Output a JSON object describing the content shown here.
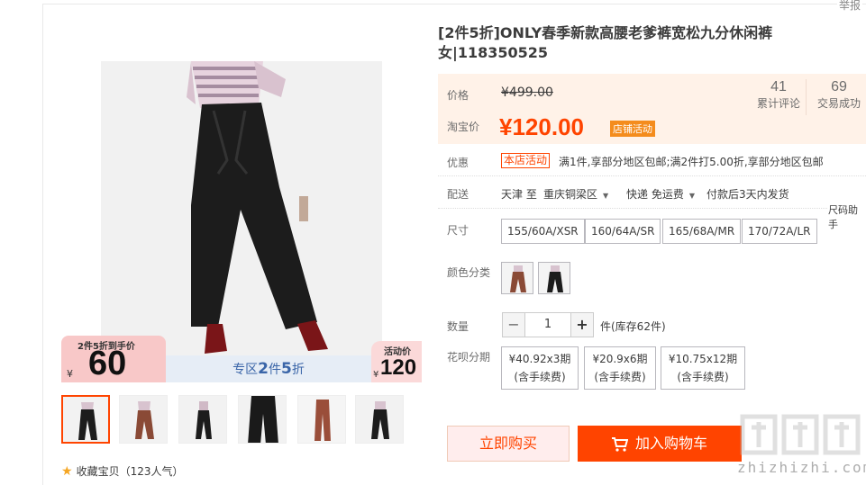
{
  "header": {
    "report": "举报"
  },
  "product": {
    "title": "[2件5折]ONLY春季新款高腰老爹裤宽松九分休闲裤女|118350525"
  },
  "promo_banner": {
    "left_small": "2件5折到手价",
    "left_yen": "¥",
    "left_price": "60",
    "mid_prefix": "专区",
    "mid_bold1": "2",
    "mid_text": "件",
    "mid_bold2": "5",
    "mid_suffix": "折",
    "right_small": "活动价",
    "right_yen": "¥",
    "right_price": "120"
  },
  "favorite": {
    "icon": "star-icon",
    "label": "收藏宝贝（123人气）"
  },
  "price": {
    "label_price": "价格",
    "original": "¥499.00",
    "label_tb": "淘宝价",
    "current": "¥120.00",
    "store_tag": "店铺活动",
    "reviews_num": "41",
    "reviews_label": "累计评论",
    "deals_num": "69",
    "deals_label": "交易成功"
  },
  "promotion": {
    "label": "优惠",
    "tag": "本店活动",
    "text": "满1件,享部分地区包邮;满2件打5.00折,享部分地区包邮"
  },
  "shipping": {
    "label": "配送",
    "from": "天津 至",
    "to": "重庆铜梁区",
    "method": "快递 免运费",
    "promise": "付款后3天内发货"
  },
  "size_help": "尺码助手",
  "sizes": {
    "label": "尺寸",
    "options": [
      "155/60A/XSR",
      "160/64A/SR",
      "165/68A/MR",
      "170/72A/LR"
    ]
  },
  "colors": {
    "label": "颜色分类"
  },
  "quantity": {
    "label": "数量",
    "minus": "−",
    "value": "1",
    "plus": "+",
    "stock": "件(库存62件)"
  },
  "installments": {
    "label": "花呗分期",
    "options": [
      {
        "line1": "¥40.92x3期",
        "line2": "(含手续费)"
      },
      {
        "line1": "¥20.9x6期",
        "line2": "(含手续费)"
      },
      {
        "line1": "¥10.75x12期",
        "line2": "(含手续费)"
      }
    ]
  },
  "actions": {
    "buy_now": "立即购买",
    "add_cart": "加入购物车"
  },
  "watermark": {
    "text": "zhizhizhi.com"
  },
  "colors_theme": {
    "accent": "#ff4400",
    "price_bg": "#fff2e8"
  }
}
